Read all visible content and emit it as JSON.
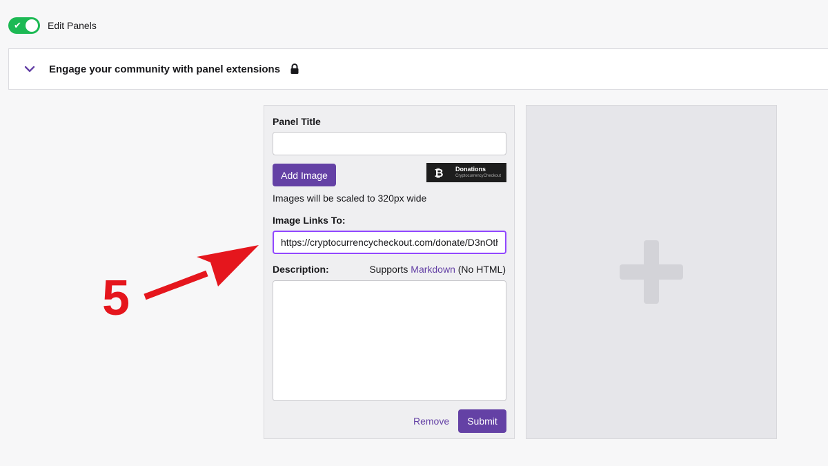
{
  "toggle": {
    "label": "Edit Panels",
    "on": true,
    "check_glyph": "✔"
  },
  "extensions_bar": {
    "title": "Engage your community with panel extensions",
    "chevron_icon": "chevron-down-icon",
    "lock_icon": "lock-icon"
  },
  "panel_form": {
    "title_label": "Panel Title",
    "title_value": "",
    "add_image_label": "Add Image",
    "image_preview": {
      "title": "Donations",
      "subtitle": "CryptocurrencyCheckout"
    },
    "image_note": "Images will be scaled to 320px wide",
    "links_label": "Image Links To:",
    "links_value": "https://cryptocurrencycheckout.com/donate/D3nOth",
    "description_label": "Description:",
    "supports_prefix": "Supports",
    "supports_link": "Markdown",
    "supports_suffix": "(No HTML)",
    "description_value": "",
    "remove_label": "Remove",
    "submit_label": "Submit"
  },
  "add_panel": {
    "icon": "plus-icon"
  },
  "annotation": {
    "number": "5",
    "color": "#e5161d"
  },
  "colors": {
    "accent": "#6441a5",
    "toggle_on": "#1db954",
    "focus": "#9147ff"
  }
}
